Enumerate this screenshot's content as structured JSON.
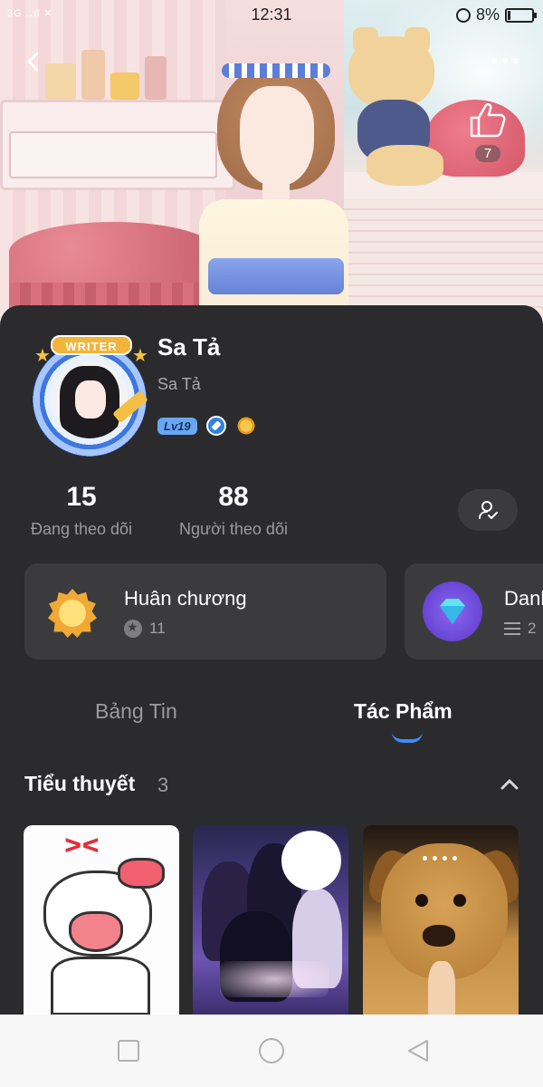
{
  "status_bar": {
    "signal": "3G ..ıl ✕",
    "time": "12:31",
    "battery": "8%"
  },
  "header": {
    "likes": "7"
  },
  "profile": {
    "avatar_badge": "WRITER",
    "name": "Sa Tả",
    "handle": "Sa Tả",
    "level": "Lv19"
  },
  "stats": [
    {
      "value": "15",
      "label": "Đang theo dõi"
    },
    {
      "value": "88",
      "label": "Người theo dõi"
    }
  ],
  "cards": [
    {
      "title": "Huân chương",
      "count": "11"
    },
    {
      "title": "Danh",
      "count": "2"
    }
  ],
  "tabs": [
    {
      "label": "Bảng Tin",
      "active": false
    },
    {
      "label": "Tác Phẩm",
      "active": true
    }
  ],
  "section": {
    "title": "Tiểu thuyết",
    "count": "3"
  },
  "colors": {
    "panel": "#2b2b2d",
    "card": "#3b3b3e",
    "accent": "#3c8df2",
    "level_badge": "#6aa7f2"
  },
  "icons": [
    "back-icon",
    "more-icon",
    "thumbs-up-icon",
    "follow-user-icon",
    "medal-icon",
    "diamond-icon",
    "star-icon",
    "list-icon",
    "chevron-up-icon",
    "nav-recent-icon",
    "nav-home-icon",
    "nav-back-icon"
  ]
}
